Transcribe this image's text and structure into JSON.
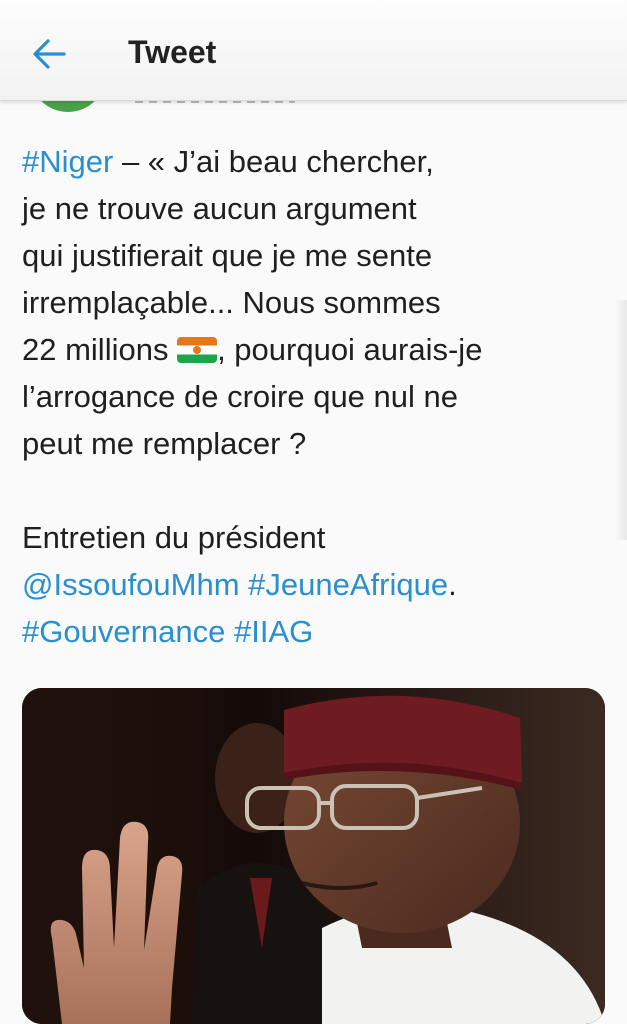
{
  "header": {
    "title": "Tweet",
    "back_icon": "arrow-left-icon"
  },
  "tweet": {
    "line1_tag": "#Niger",
    "line1_rest": " – « J’ai beau chercher,",
    "line2": "je ne trouve aucun argument",
    "line3": "qui justifierait que je me sente",
    "line4": "irremplaçable... Nous sommes",
    "line5_pre": "22 millions ",
    "line5_flag": "niger-flag-emoji",
    "line5_post": ", pourquoi aurais-je",
    "line6": "l’arrogance de croire que nul ne",
    "line7": "peut me remplacer ?",
    "line8": "Entretien du président",
    "mention": "@IssoufouMhm",
    "tag_jeune": "#JeuneAfrique",
    "line9_end": ".",
    "tag_gouv": "#Gouvernance",
    "tag_iiag": "#IIAG"
  },
  "colors": {
    "link": "#2a8fcf",
    "text": "#1f1f1f",
    "avatar": "#4aa048"
  }
}
